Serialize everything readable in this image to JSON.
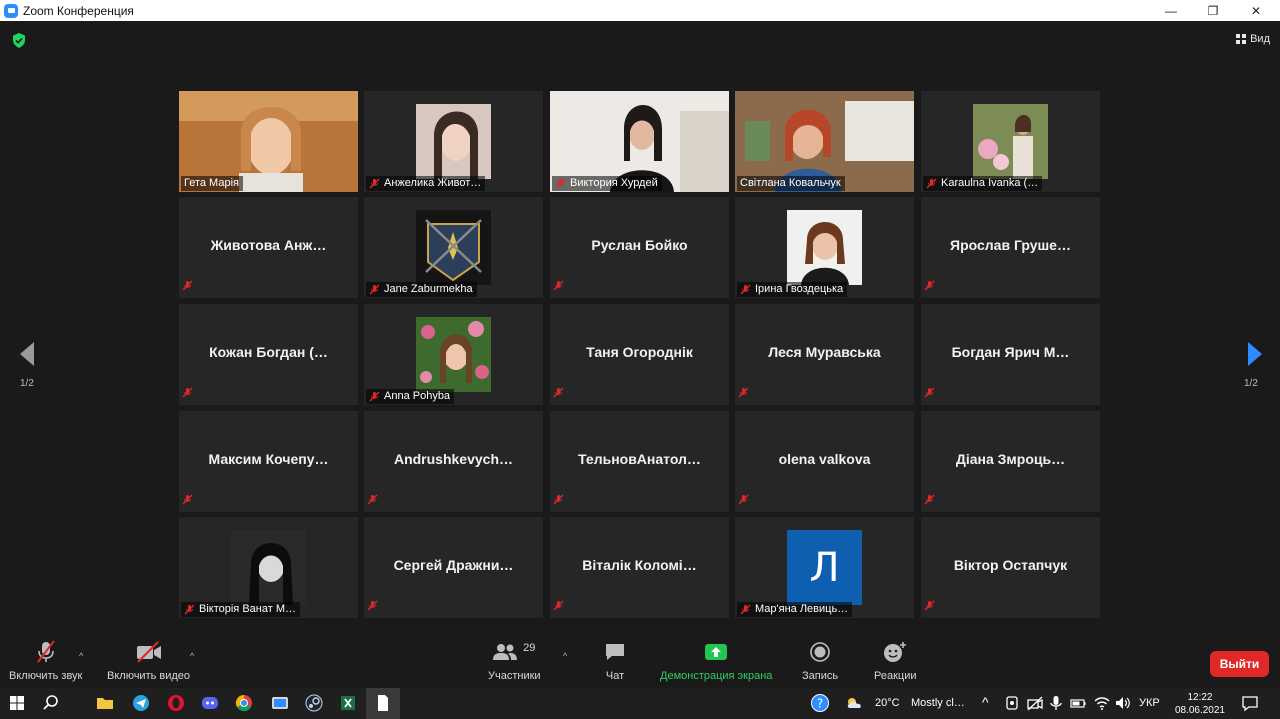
{
  "window": {
    "title": "Zoom Конференция",
    "minimize_icon": "—",
    "restore_icon": "❐",
    "close_icon": "✕"
  },
  "meeting": {
    "view_label": "Вид",
    "page_left": "1/2",
    "page_right": "1/2",
    "colors": {
      "accent": "#2d8cff",
      "active_border": "#c8e36a",
      "mute": "#e02828",
      "tile_bg": "#262626"
    }
  },
  "participants": [
    {
      "name": "Гета Марія",
      "kind": "video",
      "muted": false
    },
    {
      "name": "Анжелика Живот…",
      "kind": "photo",
      "muted": true
    },
    {
      "name": "Виктория  Хурдей",
      "kind": "video",
      "muted": true
    },
    {
      "name": "Світлана Ковальчук",
      "kind": "video",
      "muted": false,
      "active": true
    },
    {
      "name": "Karaulna Ivanka (…",
      "kind": "photo",
      "muted": true
    },
    {
      "name": "Животова  Анж…",
      "kind": "text",
      "muted": true
    },
    {
      "name": "Jane Zaburmekha",
      "kind": "photo",
      "muted": true
    },
    {
      "name": "Руслан Бойко",
      "kind": "text",
      "muted": true
    },
    {
      "name": "Ірина Гвоздецька",
      "kind": "photo",
      "muted": true
    },
    {
      "name": "Ярослав  Груше…",
      "kind": "text",
      "muted": true
    },
    {
      "name": "Кожан  Богдан  (…",
      "kind": "text",
      "muted": true
    },
    {
      "name": "Anna Pohyba",
      "kind": "photo",
      "muted": true
    },
    {
      "name": "Таня Огороднік",
      "kind": "text",
      "muted": true
    },
    {
      "name": "Леся Муравська",
      "kind": "text",
      "muted": true
    },
    {
      "name": "Богдан Ярич  М…",
      "kind": "text",
      "muted": true
    },
    {
      "name": "Максим  Кочепу…",
      "kind": "text",
      "muted": true
    },
    {
      "name": "Andrushkevych…",
      "kind": "text",
      "muted": true
    },
    {
      "name": "ТельновАнатол…",
      "kind": "text",
      "muted": true
    },
    {
      "name": "olena valkova",
      "kind": "text",
      "muted": true
    },
    {
      "name": "Діана  Змроць…",
      "kind": "text",
      "muted": true
    },
    {
      "name": "Вікторія Ванат М…",
      "kind": "photo",
      "muted": true
    },
    {
      "name": "Сергей  Дражни…",
      "kind": "text",
      "muted": true
    },
    {
      "name": "Віталік Коломі…",
      "kind": "text",
      "muted": true
    },
    {
      "name": "Мар'яна Левиць…",
      "kind": "letter",
      "letter": "Л",
      "muted": true
    },
    {
      "name": "Віктор Остапчук",
      "kind": "text",
      "muted": true
    }
  ],
  "toolbar": {
    "unmute_label": "Включить звук",
    "start_video_label": "Включить видео",
    "participants_label": "Участники",
    "participants_count": "29",
    "chat_label": "Чат",
    "share_label": "Демонстрация экрана",
    "record_label": "Запись",
    "reactions_label": "Реакции",
    "leave_label": "Выйти"
  },
  "taskbar": {
    "weather_temp": "20°C",
    "weather_text": "Mostly cl…",
    "language": "УКР",
    "time": "12:22",
    "date": "08.06.2021"
  }
}
